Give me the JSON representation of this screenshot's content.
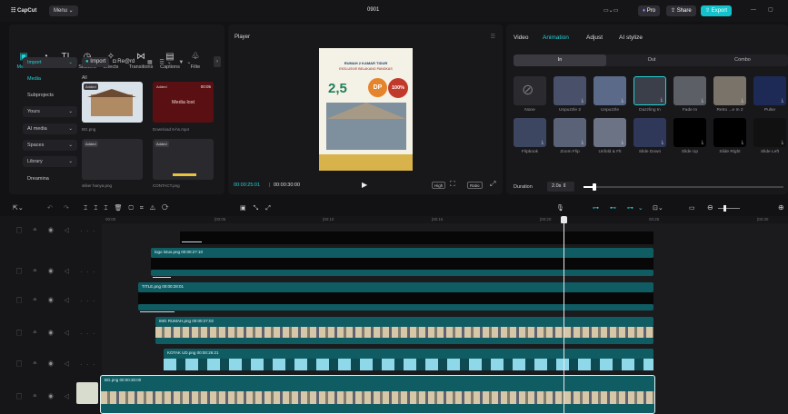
{
  "app": {
    "logo": "CapCut",
    "menu_label": "Menu",
    "title": "0901"
  },
  "topbar": {
    "pro_label": "Pro",
    "share_label": "Share",
    "export_label": "Export"
  },
  "toolbar": {
    "media": "Media",
    "audio": "Audio",
    "text": "Text",
    "stickers": "Stickers",
    "effects": "Effects",
    "transitions": "Transitions",
    "captions": "Captions",
    "filters": "Filte"
  },
  "media_panel": {
    "import_label": "Import",
    "record_label": "Re@rd",
    "all_label": "All",
    "sidebar": [
      {
        "label": "Import"
      },
      {
        "label": "Media"
      },
      {
        "label": "Subprojects"
      },
      {
        "label": "Yours"
      },
      {
        "label": "AI media"
      },
      {
        "label": "Spaces"
      },
      {
        "label": "Library"
      },
      {
        "label": "Dreamina"
      }
    ],
    "items": [
      {
        "badge": "Added",
        "caption": "BG.png"
      },
      {
        "badge": "Added",
        "time": "00:05",
        "status": "Media lost",
        "caption": "Download 6-hs.mp4"
      },
      {
        "badge": "Added",
        "caption": "stiker hanya.png"
      },
      {
        "badge": "Added",
        "caption": "CONTACT.png"
      }
    ]
  },
  "player": {
    "title": "Player",
    "current_time": "00:00:25:01",
    "total_time": "00:00:30:00",
    "quality": "High",
    "ratio_label": "Ratio",
    "canvas_text": {
      "heading1": "RUMAH 2 KAMAR TIDUR",
      "heading2": "EKSLUSIVE BELAKANG PANGKAS",
      "price": "2,5",
      "dp": "DP",
      "percent": "100%"
    }
  },
  "right_panel": {
    "tabs": [
      "Video",
      "Animation",
      "Adjust",
      "AI stylize"
    ],
    "subtabs": [
      "In",
      "Out",
      "Combo"
    ],
    "animations": [
      {
        "name": "None",
        "icon": "no-entry-icon"
      },
      {
        "name": "Unpuzzle 2"
      },
      {
        "name": "Unpuzzle"
      },
      {
        "name": "Dazzling In"
      },
      {
        "name": "Fade In"
      },
      {
        "name": "Retro ...e In 2"
      },
      {
        "name": "Pulse"
      },
      {
        "name": "Flipbook"
      },
      {
        "name": "Zoom Flip"
      },
      {
        "name": "Unfold & Flt"
      },
      {
        "name": "Slide Down"
      },
      {
        "name": "Slide Up"
      },
      {
        "name": "Slide Right"
      },
      {
        "name": "Slide Left"
      }
    ],
    "duration_label": "Duration",
    "duration_value": "2.0s"
  },
  "timeline": {
    "ruler": [
      "00:00",
      "|00:05",
      "|00:10",
      "|00:15",
      "|00:20",
      "00:25",
      "|00:30"
    ],
    "clips": [
      {
        "title": "logo lotus.png  00:00:27:10"
      },
      {
        "title": "TITLE.png  00:00:28:01"
      },
      {
        "title": "IMG RUMAH.png  00:00:27:02"
      },
      {
        "title": "KOTAK UD.png  00:00:26:21"
      },
      {
        "title": "BG.png  00:00:30:00"
      }
    ],
    "track_controls": "▢ ᅀ ◉ ◁ ···"
  },
  "colors": {
    "accent": "#25d1d6",
    "teal_clip": "#0f5c63",
    "export": "#12c2cc"
  }
}
